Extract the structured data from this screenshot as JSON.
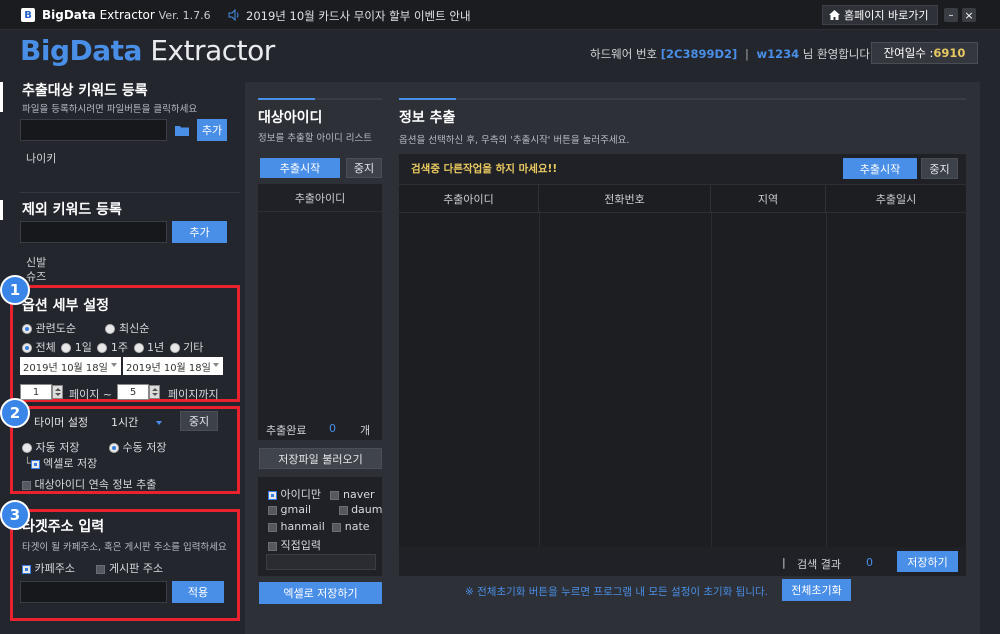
{
  "titlebar": {
    "logo_letter": "B",
    "app_name_bold": "BigData",
    "app_name_rest": "Extractor",
    "version": "Ver. 1.7.6",
    "notice": "2019년 10월 카드사 무이자 할부 이벤트 안내",
    "homepage_label": "홈페이지 바로가기",
    "minimize": "–",
    "close": "×"
  },
  "header": {
    "brand_big": "BigData",
    "brand_rest": "Extractor",
    "hw_label": "하드웨어 번호",
    "hw_code": "[2C3899D2]",
    "separator": "|",
    "user_id": "w1234",
    "welcome": "님 환영합니다!",
    "remaining_label": "잔여일수 :",
    "remaining_value": "6910"
  },
  "left": {
    "keyword_title": "추출대상 키워드 등록",
    "keyword_hint": "파일을 등록하시려면 파일버튼을 클릭하세요",
    "keyword_add": "추가",
    "keywords": [
      "나이키"
    ],
    "exclude_title": "제외 키워드 등록",
    "exclude_add": "추가",
    "excludes": [
      "신발",
      "슈즈"
    ],
    "option_title": "옵션 세부 설정",
    "sort_options": [
      "관련도순",
      "최신순"
    ],
    "period_options": [
      "전체",
      "1일",
      "1주",
      "1년",
      "기타"
    ],
    "date_from": "2019년 10월 18일",
    "date_to": "2019년 10월 18일",
    "page_from": "1",
    "page_label": "페이지 ~",
    "page_to": "5",
    "page_until": "페이지까지",
    "timer_label": "타이머 설정",
    "timer_value": "1시간",
    "timer_stop": "중지",
    "save_auto": "자동 저장",
    "save_manual": "수동 저장",
    "save_excel": "엑셀로 저장",
    "continuous": "대상아이디 연속 정보 추출",
    "target_title": "타겟주소 입력",
    "target_hint": "타겟이 될 카페주소, 혹은 게시판 주소를 입력하세요",
    "target_cafe": "카페주소",
    "target_board": "게시판 주소",
    "target_apply": "적용",
    "badges": [
      "1",
      "2",
      "3"
    ]
  },
  "middle": {
    "title": "대상아이디",
    "subtitle": "정보를 추출할 아이디 리스트",
    "start": "추출시작",
    "stop": "중지",
    "col_header": "추출아이디",
    "done_label": "추출완료",
    "done_count": "0",
    "done_unit": "개",
    "load_file": "저장파일 불러오기",
    "checks": {
      "id_only": "아이디만",
      "naver": "naver",
      "gmail": "gmail",
      "daum": "daum",
      "hanmail": "hanmail",
      "nate": "nate",
      "direct": "직접입력"
    },
    "save_excel": "엑셀로 저장하기"
  },
  "right": {
    "title": "정보 추출",
    "subtitle": "옵션을 선택하신 후, 우측의 '추출시작' 버튼을 눌러주세요.",
    "warning": "검색중 다른작업을 하지 마세요!!",
    "start": "추출시작",
    "stop": "중지",
    "columns": [
      "추출아이디",
      "전화번호",
      "지역",
      "추출일시"
    ],
    "result_sep": "|",
    "result_label": "검색 결과",
    "result_count": "0",
    "save": "저장하기",
    "reset_notice": "※ 전체초기화 버튼을 누르면 프로그램 내 모든 설정이 초기화 됩니다.",
    "reset": "전체초기화"
  },
  "colors": {
    "accent": "#4a8fe7",
    "highlight": "#e8222e",
    "background": "#23262d"
  }
}
